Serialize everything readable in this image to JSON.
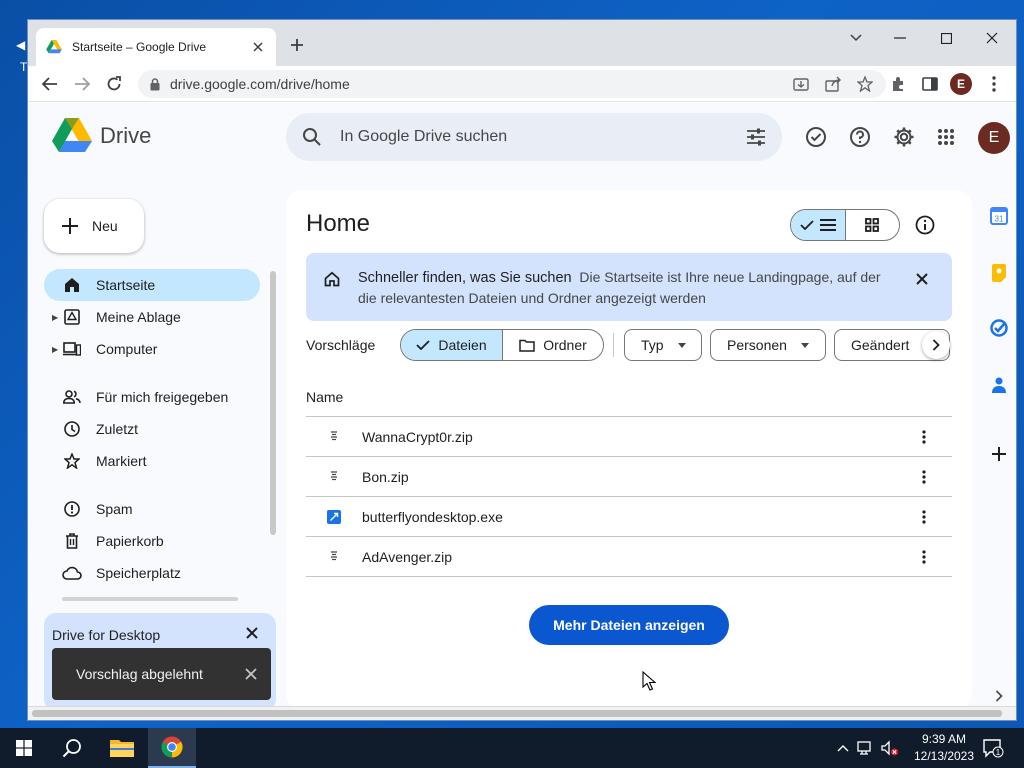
{
  "desktop": {
    "fragment_char": "T"
  },
  "browser": {
    "tab_title": "Startseite – Google Drive",
    "url": "drive.google.com/drive/home",
    "profile_initial": "E"
  },
  "drive": {
    "app_name": "Drive",
    "search_placeholder": "In Google Drive suchen",
    "avatar_initial": "E",
    "new_button": "Neu",
    "nav": [
      {
        "label": "Startseite",
        "icon": "home-icon",
        "active": true
      },
      {
        "label": "Meine Ablage",
        "icon": "my-drive-icon"
      },
      {
        "label": "Computer",
        "icon": "computer-icon"
      },
      {
        "label": "Für mich freigegeben",
        "icon": "shared-icon"
      },
      {
        "label": "Zuletzt",
        "icon": "clock-icon"
      },
      {
        "label": "Markiert",
        "icon": "star-icon"
      },
      {
        "label": "Spam",
        "icon": "spam-icon"
      },
      {
        "label": "Papierkorb",
        "icon": "trash-icon"
      },
      {
        "label": "Speicherplatz",
        "icon": "cloud-icon"
      }
    ],
    "drive_for_desktop": "Drive for Desktop",
    "snackbar": "Vorschlag abgelehnt",
    "page_title": "Home",
    "banner": {
      "title": "Schneller finden, was Sie suchen",
      "text": "Die Startseite ist Ihre neue Landingpage, auf der die relevantesten Dateien und Ordner angezeigt werden"
    },
    "suggestions_label": "Vorschläge",
    "seg_files": "Dateien",
    "seg_folders": "Ordner",
    "filters": [
      "Typ",
      "Personen",
      "Geändert"
    ],
    "column_name": "Name",
    "files": [
      {
        "name": "WannaCrypt0r.zip",
        "icon": "zip-file-icon"
      },
      {
        "name": "Bon.zip",
        "icon": "zip-file-icon"
      },
      {
        "name": "butterflyondesktop.exe",
        "icon": "exe-file-icon"
      },
      {
        "name": "AdAvenger.zip",
        "icon": "zip-file-icon"
      }
    ],
    "more_files_button": "Mehr Dateien anzeigen"
  },
  "taskbar": {
    "time": "9:39 AM",
    "date": "12/13/2023",
    "notifications": "1"
  },
  "colors": {
    "accent": "#0b57d0",
    "active_nav": "#c2e7ff",
    "banner": "#d3e3fd"
  }
}
